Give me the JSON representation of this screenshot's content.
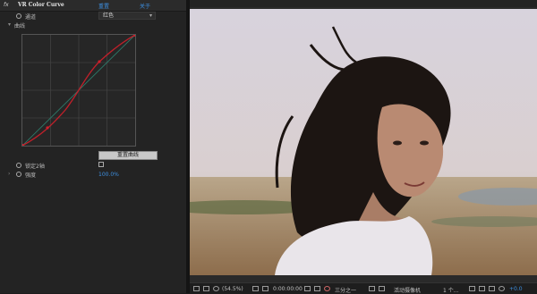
{
  "effect": {
    "fx_label": "fx",
    "name": "VR Color Curve",
    "reset_link": "重置",
    "about_link": "关于"
  },
  "params": {
    "channel_label": "通道",
    "channel_value": "红色",
    "curve_label": "曲线",
    "reset_curve_label": "重置曲线",
    "lock_label": "锁定2轴",
    "intensity_label": "强度",
    "intensity_value": "100.0%"
  },
  "status_bar": {
    "zoom": "(54.5%)",
    "timecode": "0:00:00:00",
    "resolution": "三分之一",
    "camera": "活动摄像机",
    "views": "1 个...",
    "exposure": "+0.0"
  },
  "colors": {
    "accent_blue": "#3d8fe0",
    "curve_red": "#c0202a",
    "panel_bg": "#232323"
  }
}
